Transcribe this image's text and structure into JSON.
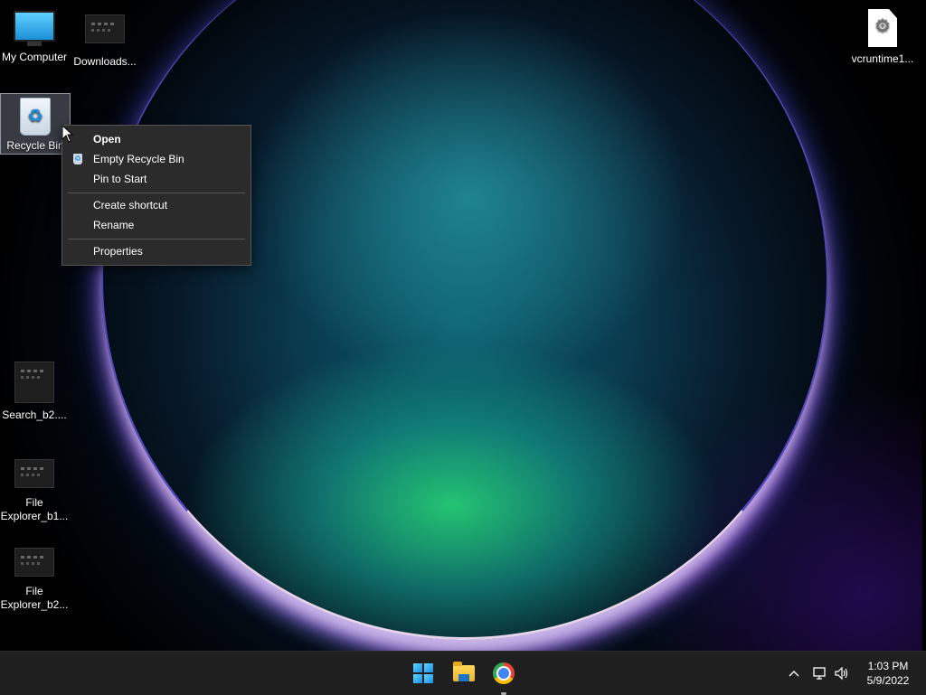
{
  "desktop": {
    "icons": [
      {
        "label": "My Computer",
        "icon": "monitor-icon"
      },
      {
        "label": "Downloads...",
        "icon": "folder-thumbnail-icon"
      },
      {
        "label": "vcruntime1...",
        "icon": "settings-file-icon"
      },
      {
        "label": "Recycle Bin",
        "icon": "recycle-bin-icon"
      },
      {
        "label": "Search_b2....",
        "icon": "screenshot-thumbnail-icon"
      },
      {
        "label": "File Explorer_b1...",
        "icon": "screenshot-thumbnail-icon"
      },
      {
        "label": "File Explorer_b2...",
        "icon": "screenshot-thumbnail-icon"
      }
    ]
  },
  "context_menu": {
    "items": [
      {
        "label": "Open",
        "bold": true
      },
      {
        "label": "Empty Recycle Bin",
        "icon": "recycle-bin-icon"
      },
      {
        "label": "Pin to Start"
      },
      {
        "label": "Create shortcut"
      },
      {
        "label": "Rename"
      },
      {
        "label": "Properties"
      }
    ]
  },
  "taskbar": {
    "apps": [
      {
        "name": "Start",
        "icon": "windows-logo-icon"
      },
      {
        "name": "File Explorer",
        "icon": "folder-icon"
      },
      {
        "name": "Google Chrome",
        "icon": "chrome-icon",
        "running": true
      }
    ],
    "tray": {
      "chevron": "^",
      "network": "network-icon",
      "volume": "volume-icon"
    },
    "clock": {
      "time": "1:03 PM",
      "date": "5/9/2022"
    }
  },
  "colors": {
    "taskbar_bg": "#1f1f1f",
    "menu_bg": "#2b2b2b",
    "accent": "#1a8fe6"
  }
}
